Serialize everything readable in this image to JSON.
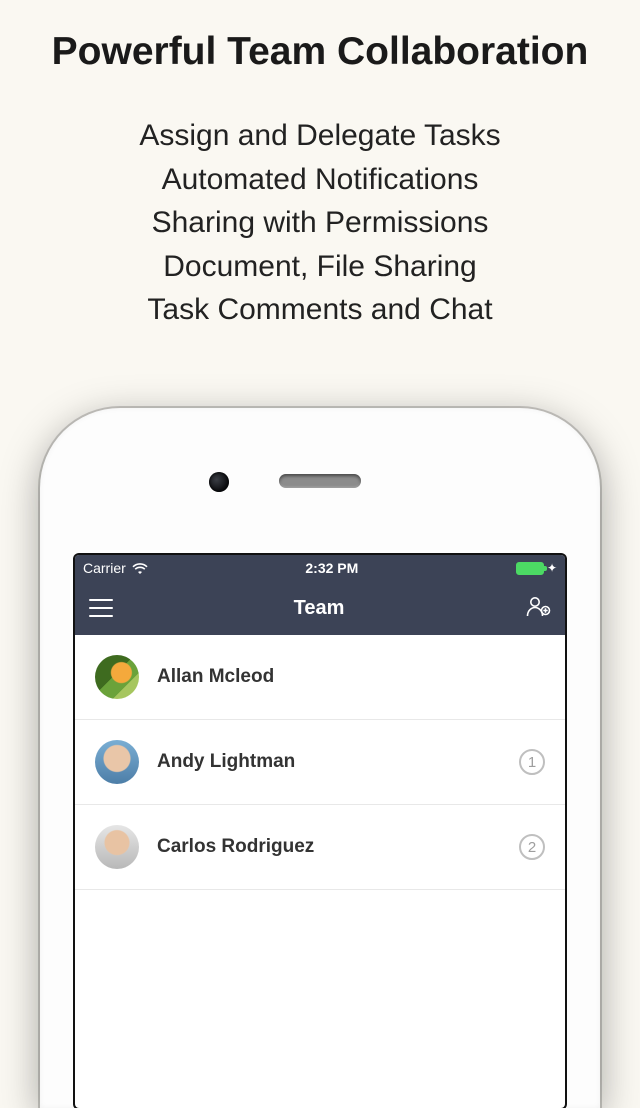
{
  "promo": {
    "title": "Powerful Team Collaboration",
    "bullets": [
      "Assign and Delegate Tasks",
      "Automated Notifications",
      "Sharing with Permissions",
      "Document, File Sharing",
      "Task Comments and Chat"
    ]
  },
  "statusbar": {
    "carrier": "Carrier",
    "time": "2:32 PM"
  },
  "navbar": {
    "title": "Team"
  },
  "team": {
    "rows": [
      {
        "name": "Allan Mcleod",
        "badge": ""
      },
      {
        "name": "Andy Lightman",
        "badge": "1"
      },
      {
        "name": "Carlos Rodriguez",
        "badge": "2"
      }
    ]
  }
}
